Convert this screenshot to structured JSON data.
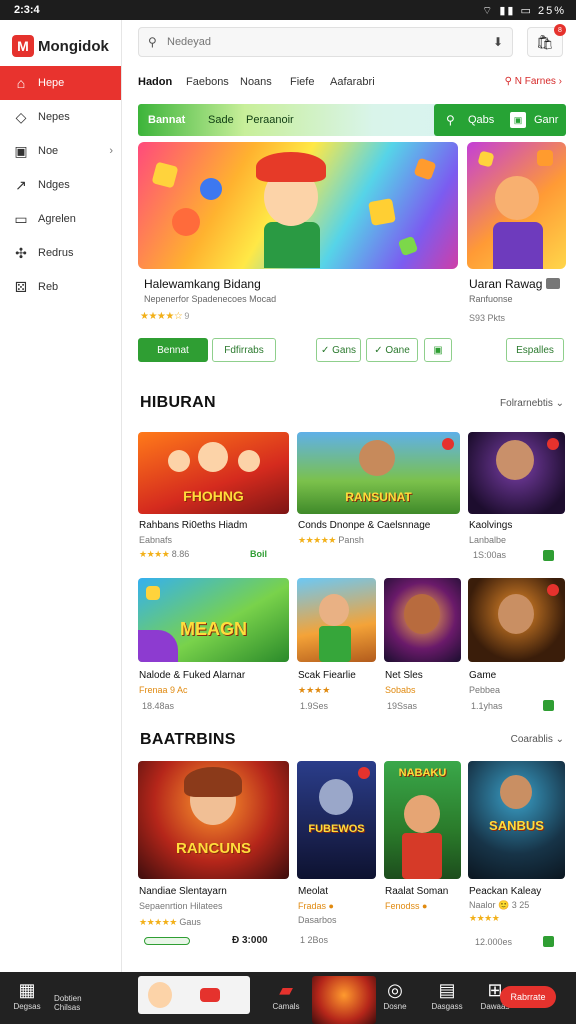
{
  "status": {
    "time": "2:3:4",
    "right": "⌔ ▮▮ ▭ 25%"
  },
  "brand": {
    "logo": "M",
    "name": "Mongidok"
  },
  "sidebar": {
    "items": [
      {
        "label": "Hepe",
        "icon": "home-icon",
        "glyph": "⌂",
        "active": true
      },
      {
        "label": "Nepes",
        "icon": "tag-icon",
        "glyph": "◇"
      },
      {
        "label": "Noe",
        "icon": "image-icon",
        "glyph": "▣",
        "chevron": "›"
      },
      {
        "label": "Ndges",
        "icon": "trend-icon",
        "glyph": "↗"
      },
      {
        "label": "Agrelen",
        "icon": "calendar-icon",
        "glyph": "▭"
      },
      {
        "label": "Redrus",
        "icon": "puzzle-icon",
        "glyph": "✣"
      },
      {
        "label": "Reb",
        "icon": "gamepad-icon",
        "glyph": "⚄"
      }
    ]
  },
  "search": {
    "placeholder": "Nedeyad",
    "mic": "⬇"
  },
  "notifications": {
    "badge": "8"
  },
  "tabs": [
    "Hadon",
    "Faebons",
    "Noans",
    "Fiefe",
    "Aafarabri"
  ],
  "promo": "⚲ N Farnes ›",
  "greenbar": {
    "items": [
      "Bannat",
      "Sade",
      "Peraanoir"
    ],
    "right_label": "Qabs",
    "right_label2": "Ganr",
    "right_icon_glyph": "▣"
  },
  "hero": {
    "title": "Halewamkang Bidang",
    "subtitle": "Nepenerfor Spadenecoes Mocad",
    "stars": "★★★★☆",
    "rating_suffix": "9"
  },
  "hero2": {
    "title": "Uaran Rawag",
    "subtitle": "Ranfuonse",
    "price": "S93 Pkts"
  },
  "buttons": {
    "primary": "Bennat",
    "secondary": "Fdfirrabs",
    "b3": "✓ Gans",
    "b4": "✓ Oane",
    "b5": "▣",
    "b6": "Espalles"
  },
  "section1": {
    "title": "HIBURAN",
    "more": "Folrarnebtis ⌄"
  },
  "section2": {
    "title": "BAATRBINS",
    "more": "Coarablis ⌄"
  },
  "row1": [
    {
      "logo": "FHOHNG",
      "title": "Rahbans Ri0eths Hiadm",
      "sub": "Eabnafs",
      "stars": "★★★★",
      "meta": "8.86",
      "tag": "Boil"
    },
    {
      "logo": "RANSUNAT",
      "title": "Conds Dnonpe & Caelsnnage",
      "sub": "",
      "stars": "★★★★★",
      "meta": "Pansh",
      "tag": ""
    },
    {
      "logo": "",
      "title": "Kaolvings",
      "sub": "Lanbalbe",
      "stars": "",
      "meta": "1S:00as",
      "tag": ""
    }
  ],
  "row2": [
    {
      "logo": "MEAGN",
      "title": "Nalode & Fuked Alarnar",
      "sub": "Frenaa 9 Ac",
      "meta": "18.48as",
      "tag": ""
    },
    {
      "logo": "",
      "title": "Scak Fiearlie",
      "sub": "★★★★",
      "meta": "1.9Ses",
      "tag": ""
    },
    {
      "logo": "",
      "title": "Net Sles",
      "sub": "Sobabs",
      "meta": "19Ssas",
      "tag": ""
    },
    {
      "logo": "",
      "title": "Game",
      "sub": "Pebbea",
      "meta": "1.1yhas",
      "tag": ""
    }
  ],
  "row3": [
    {
      "logo": "RANCUNS",
      "title": "Nandiae Slentayarn",
      "sub": "Sepaenrtion Hilatees",
      "stars": "★★★★★",
      "meta": "Gaus",
      "price": "Đ 3:000",
      "pill": "▬▬▬▬▬"
    },
    {
      "logo": "FUBEWOS",
      "title": "Meolat",
      "sub": "Fradas ●",
      "meta": "1 2Bos",
      "extra": "Dasarbos"
    },
    {
      "logo": "NABAKU",
      "title": "Raalat Soman",
      "sub": "Fenodss ●",
      "meta": ""
    },
    {
      "logo": "SANBUS",
      "title": "Peackan Kaleay",
      "sub": "Naalor 🙂 3 25",
      "stars": "★★★★",
      "meta": "12.000es"
    }
  ],
  "bottombar": {
    "items": [
      {
        "icon": "grid-icon",
        "glyph": "▦",
        "label": "Degsas"
      },
      {
        "label": "Dobtien Chilsas",
        "glyph": ""
      },
      {
        "icon": "chat-icon",
        "glyph": "▰",
        "label": "Camals"
      },
      {
        "icon": "headset-icon",
        "glyph": "◎",
        "label": "Dosne"
      },
      {
        "icon": "wallet-icon",
        "glyph": "▤",
        "label": "Dasgass"
      },
      {
        "icon": "gift-icon",
        "glyph": "⊞",
        "label": "Dawaas"
      }
    ],
    "cta": "Rabrrate"
  },
  "colors": {
    "accent_red": "#e5322d",
    "accent_green": "#2f9e33"
  }
}
